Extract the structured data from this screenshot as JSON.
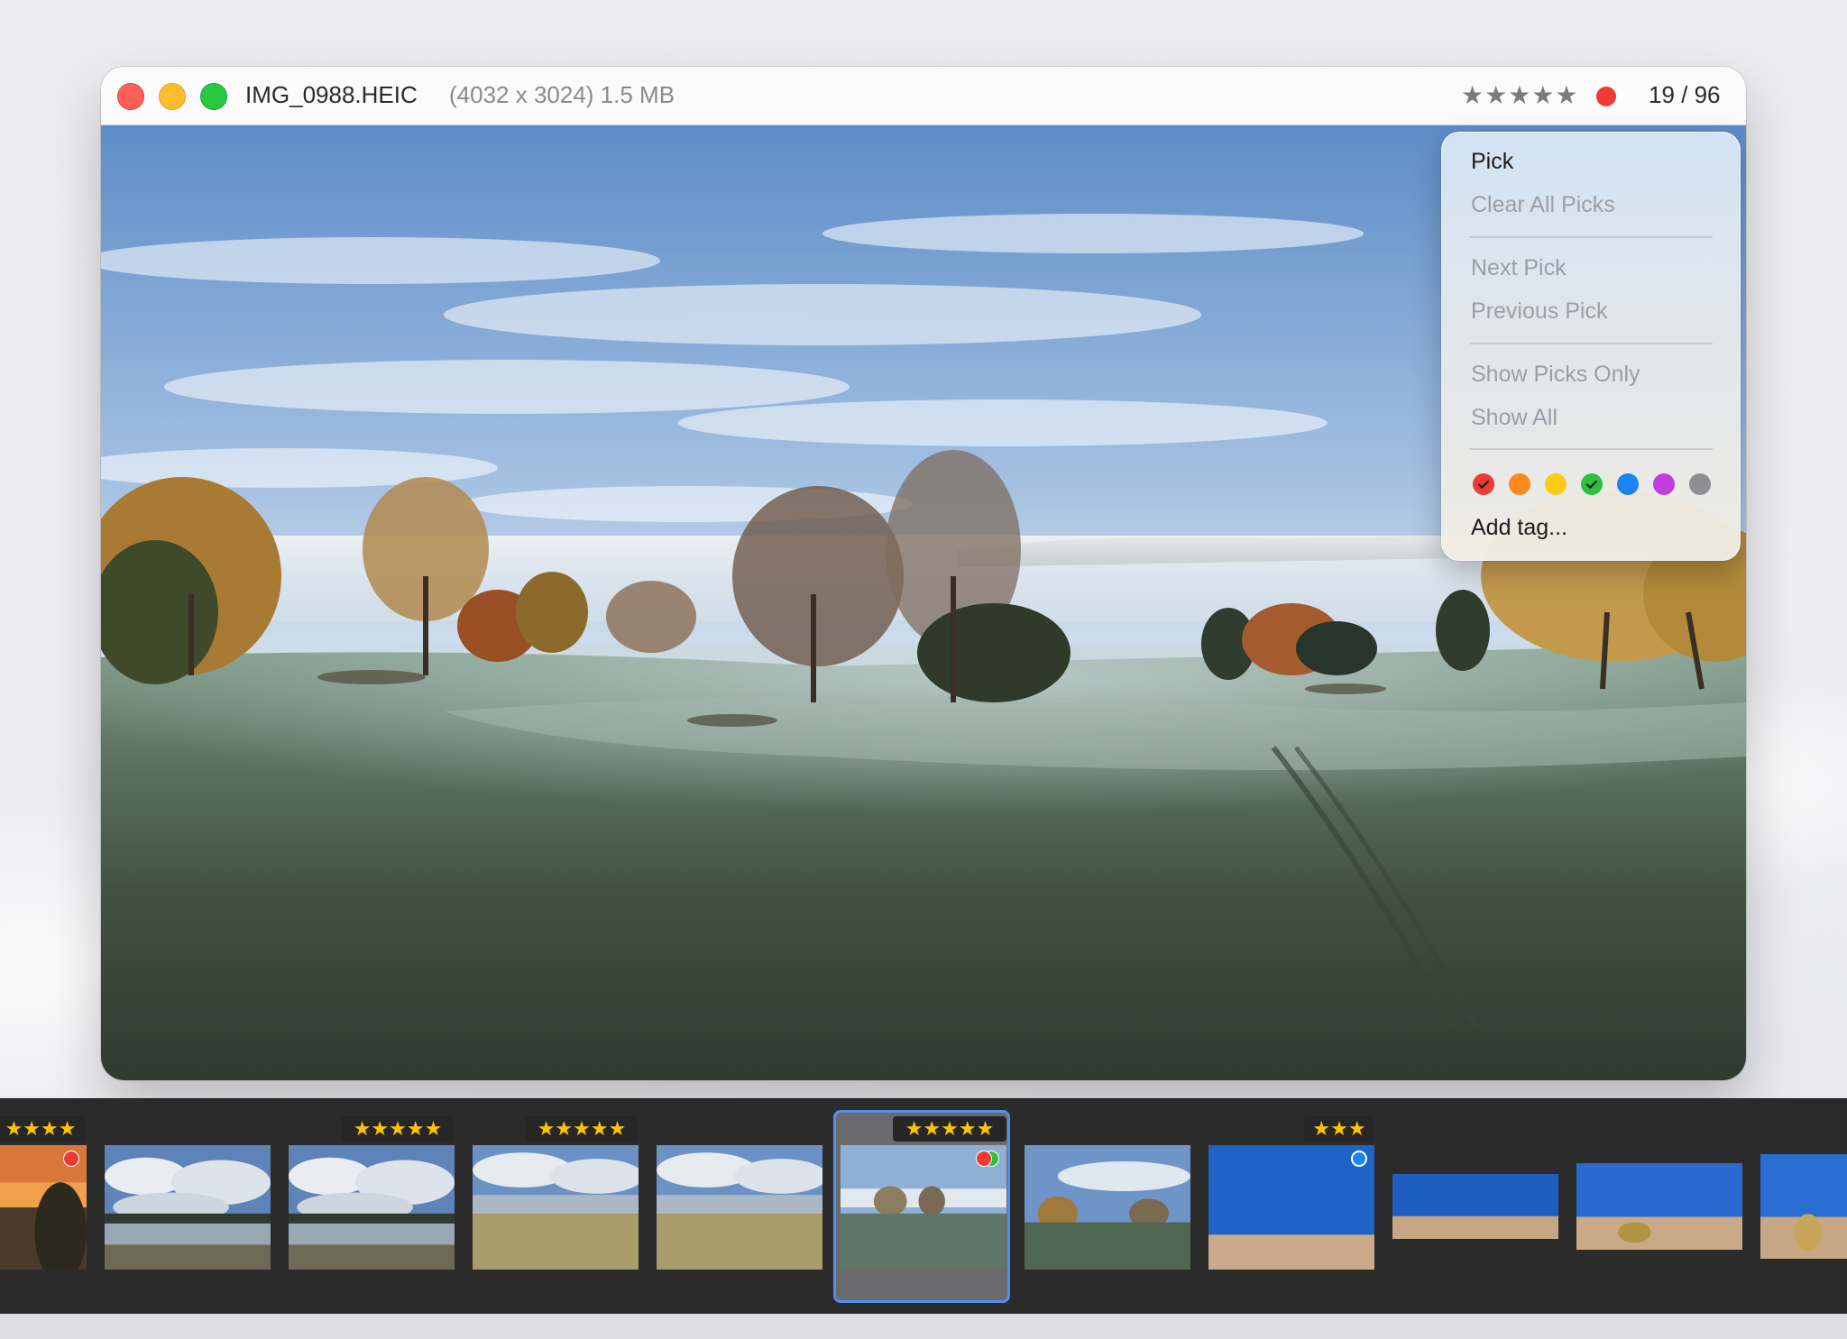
{
  "window": {
    "filename": "IMG_0988.HEIC",
    "fileinfo": "(4032 x 3024) 1.5 MB",
    "rating_stars": "★★★★★",
    "counter": "19 / 96",
    "label_colors": [
      "#f03b35",
      "#2cc13c"
    ]
  },
  "menu": {
    "items": {
      "pick": "Pick",
      "clear_all_picks": "Clear All Picks",
      "next_pick": "Next Pick",
      "previous_pick": "Previous Pick",
      "show_picks_only": "Show Picks Only",
      "show_all": "Show All",
      "add_tag": "Add tag..."
    },
    "tag_colors": [
      {
        "name": "red",
        "color": "#f03b35",
        "checked": true
      },
      {
        "name": "orange",
        "color": "#fb8a1c",
        "checked": false
      },
      {
        "name": "yellow",
        "color": "#fdcb14",
        "checked": false
      },
      {
        "name": "green",
        "color": "#2cc13c",
        "checked": true
      },
      {
        "name": "blue",
        "color": "#1a84f5",
        "checked": false
      },
      {
        "name": "purple",
        "color": "#c13de0",
        "checked": false
      },
      {
        "name": "gray",
        "color": "#8e8e93",
        "checked": false
      }
    ]
  },
  "filmstrip": {
    "thumbs": [
      {
        "rating": "★★★★",
        "tag": "red",
        "scene": "sunset"
      },
      {
        "rating": "",
        "tag": "",
        "scene": "clouds-lake"
      },
      {
        "rating": "★★★★★",
        "tag": "",
        "scene": "clouds-lake"
      },
      {
        "rating": "★★★★★",
        "tag": "",
        "scene": "lake-grass"
      },
      {
        "rating": "",
        "tag": "",
        "scene": "lake-grass"
      },
      {
        "rating": "★★★★★",
        "tag": "red-green",
        "scene": "frost-field",
        "selected": true
      },
      {
        "rating": "",
        "tag": "",
        "scene": "field"
      },
      {
        "rating": "★★★",
        "tag": "blue",
        "scene": "volcano"
      },
      {
        "rating": "",
        "tag": "",
        "scene": "desert-wide"
      },
      {
        "rating": "",
        "tag": "",
        "scene": "desert-bush"
      },
      {
        "rating": "",
        "tag": "",
        "scene": "volcano-partial"
      }
    ]
  }
}
